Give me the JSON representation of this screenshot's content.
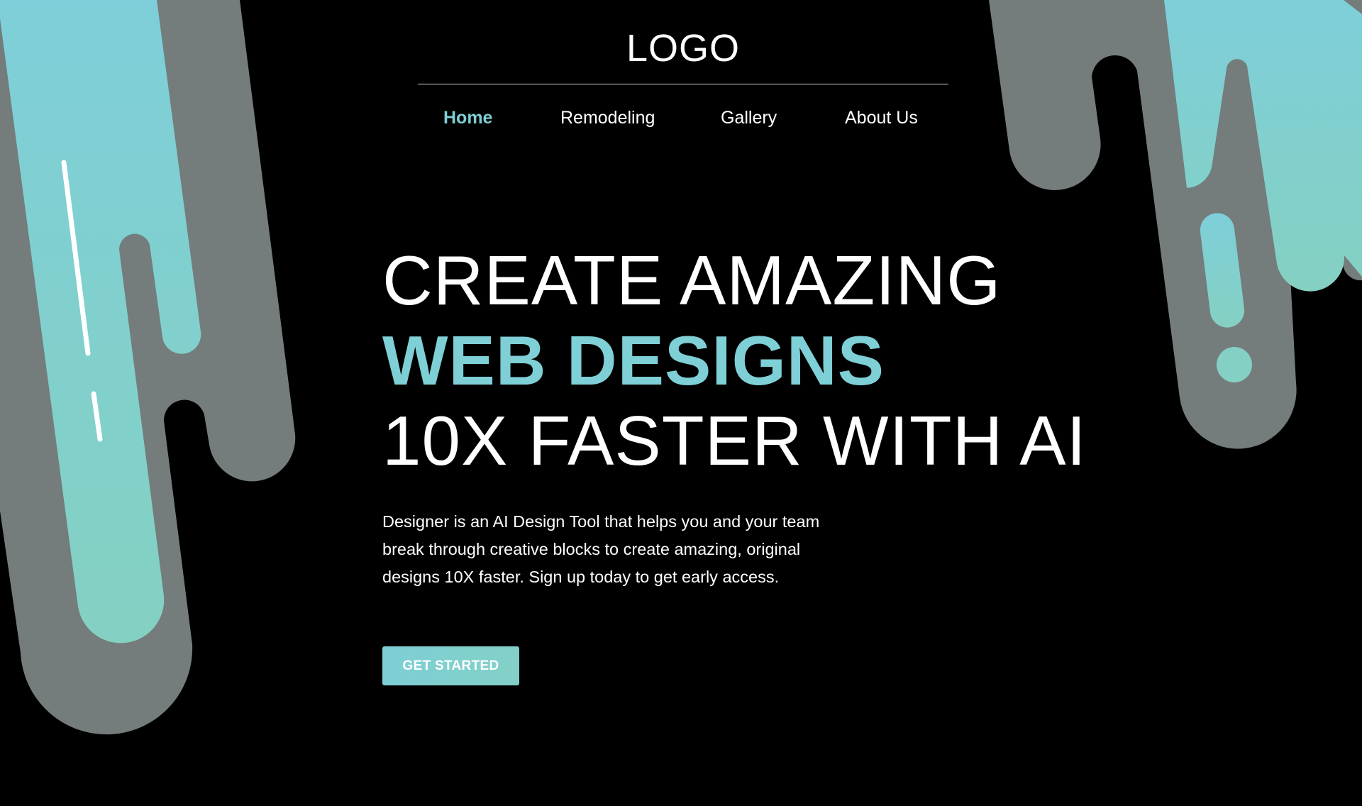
{
  "header": {
    "logo": "LOGO"
  },
  "nav": {
    "items": [
      {
        "label": "Home",
        "active": true
      },
      {
        "label": "Remodeling",
        "active": false
      },
      {
        "label": "Gallery",
        "active": false
      },
      {
        "label": "About Us",
        "active": false
      }
    ]
  },
  "hero": {
    "line1": "CREATE AMAZING",
    "line2": "WEB DESIGNS",
    "line3": "10X FASTER WITH AI",
    "description": "Designer is an AI Design Tool that helps you and your team break through creative blocks to create amazing, original designs 10X faster. Sign up today to get early access.",
    "cta_label": "GET STARTED"
  },
  "colors": {
    "background": "#000000",
    "accent": "#7ecfd6",
    "accent_green": "#84d0c2",
    "drip_gray": "#747c7c",
    "text": "#ffffff"
  }
}
